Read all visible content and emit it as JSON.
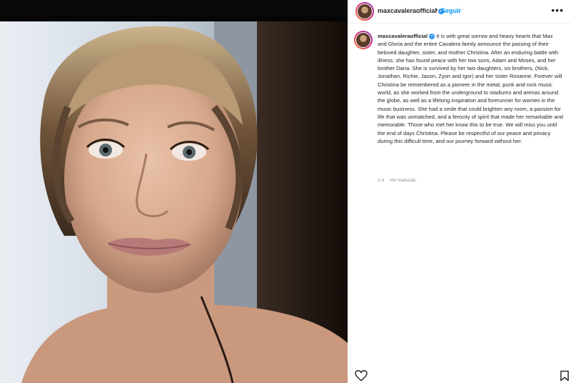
{
  "post": {
    "username": "maxcavaleraofficial",
    "follow_label": "Seguir",
    "separator": "•",
    "more_label": "•••",
    "verified_mark": "✓"
  },
  "caption": {
    "username": "maxcavaleraofficial",
    "text": "It is with great sorrow and heavy hearts that Max and Gloria and the entire Cavalera family announce the passing of their beloved daughter, sister, and mother Christina. After an enduring battle with illness, she has found peace with her two sons, Adam and Moses, and her brother Dana. She is survived by her two daughters, six brothers, (Nick, Jonathan, Richie, Jason, Zyon and Igor) and her sister Roxanne. Forever will Christina be remembered as a pioneer in the metal, punk and rock music world, as she worked from the underground to stadiums and arenas around the globe, as well as a lifelong inspiration and forerunner for women in the music business. She had a smile that could brighten any room, a passion for life that was unmatched, and a ferocity of spirit that made her remarkable and memorable. Those who met her know this to be true. We will miss you until the end of days Christina. Please be respectful of our peace and privacy during this difficult time, and our journey forward without her."
  },
  "meta": {
    "time": "1 d",
    "translate_label": "Ver tradução"
  },
  "icons": {
    "like": "heart-icon",
    "save": "bookmark-icon",
    "verified": "verified-badge-icon",
    "more": "more-options-icon"
  },
  "colors": {
    "link_blue": "#0095f6",
    "verified_blue": "#3897f0",
    "text": "#262626",
    "muted": "#8e8e8e"
  }
}
